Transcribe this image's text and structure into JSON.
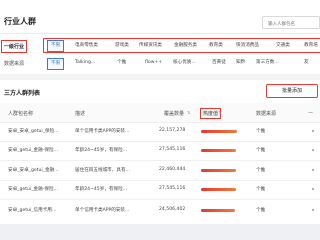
{
  "page": {
    "title": "行业人群",
    "search_placeholder": "输入人群包名"
  },
  "filters": {
    "industry": {
      "label": "一级行业",
      "selected": "不限",
      "tags": [
        "电商零售类",
        "游戏类",
        "传媒资讯类",
        "金融服务类",
        "教育类",
        "快消消费品",
        "交通类",
        "教育培"
      ]
    },
    "source": {
      "label": "数据来源",
      "selected": "不限",
      "tags": [
        "Talking...",
        "个推",
        "flow++",
        "核心优质...",
        "百黄徒",
        "知黔",
        "第三方数...",
        "友"
      ]
    }
  },
  "section": {
    "title": "三方人群列表",
    "batch_button": "批量添加"
  },
  "table": {
    "columns": [
      "人群包名称",
      "描述",
      "覆盖数量",
      "热度值",
      "数据来源"
    ],
    "rows": [
      {
        "name": "安卓_安卓_getui_保险...",
        "desc": "单个信用卡类APP的安装...",
        "count": "22,157,278",
        "heat": 0.95,
        "source": "个推"
      },
      {
        "name": "安卓_getui_金融-保险...",
        "desc": "年龄24~45岁，有保险...",
        "count": "27,545,116",
        "heat": 0.93,
        "source": "个推"
      },
      {
        "name": "安卓_安卓_getui_金融...",
        "desc": "居住在四五线城市，具有...",
        "count": "22,460,444",
        "heat": 0.92,
        "source": "个推"
      },
      {
        "name": "安卓_getui_金融-保险...",
        "desc": "年龄24~45岁，有保险...",
        "count": "27,545,116",
        "heat": 0.93,
        "source": "个推"
      },
      {
        "name": "安卓_getui_信用卡用...",
        "desc": "单个信用卡类APP的安装...",
        "count": "24,506,402",
        "heat": 0.9,
        "source": "个推"
      }
    ]
  }
}
